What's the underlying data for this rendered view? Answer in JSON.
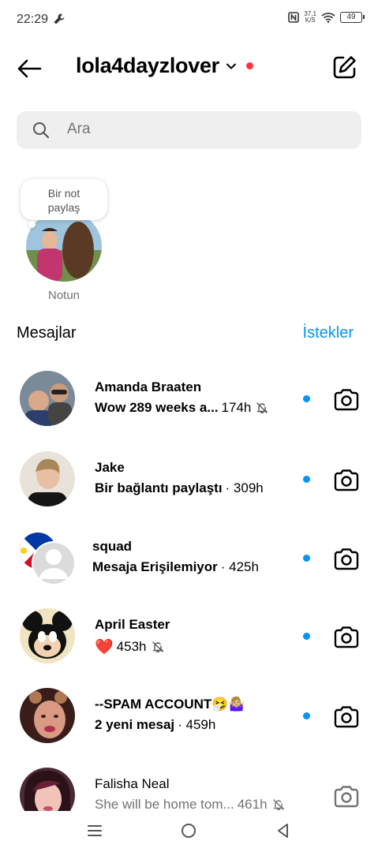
{
  "status_bar": {
    "time": "22:29",
    "speed_value": "37,1",
    "speed_unit": "K/S",
    "battery": "49"
  },
  "header": {
    "username": "lola4dayzlover"
  },
  "search": {
    "placeholder": "Ara"
  },
  "note": {
    "bubble_line1": "Bir not",
    "bubble_line2": "paylaş",
    "label": "Notun"
  },
  "messages": {
    "title": "Mesajlar",
    "requests": "İstekler"
  },
  "threads": [
    {
      "name": "Amanda Braaten",
      "message": "Wow 289 weeks a...",
      "time": "174h",
      "muted": true,
      "unread": true
    },
    {
      "name": "Jake",
      "message": "Bir bağlantı paylaştı",
      "time": "· 309h",
      "muted": false,
      "unread": true
    },
    {
      "name": "squad",
      "message": "Mesaja Erişilemiyor",
      "time": "· 425h",
      "muted": false,
      "unread": true
    },
    {
      "name": "April Easter",
      "message": "❤️",
      "time": "453h",
      "muted": true,
      "unread": true
    },
    {
      "name": "--SPAM ACCOUNT🤧🤷🏼‍♀️",
      "message": "2 yeni mesaj",
      "time": "· 459h",
      "muted": false,
      "unread": true
    },
    {
      "name": "Falisha Neal",
      "message": "She will be home tom...",
      "time": "461h",
      "muted": true,
      "unread": false
    }
  ],
  "colors": {
    "accent": "#0095f6",
    "notification": "#ff3040",
    "secondary_text": "#737373",
    "search_bg": "#efefef"
  }
}
